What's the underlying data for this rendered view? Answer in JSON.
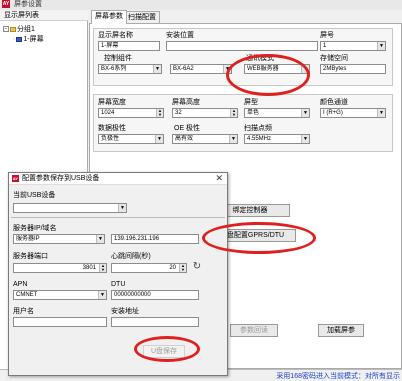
{
  "window": {
    "title": "屏参设置",
    "logo": "AY"
  },
  "tree": {
    "header": "显示屏列表",
    "group": {
      "expander": "−",
      "label": "分组1"
    },
    "screen": {
      "label": "1-屏幕"
    }
  },
  "tabs": [
    {
      "label": "屏幕参数"
    },
    {
      "label": "扫描配置"
    }
  ],
  "params": {
    "name_label": "显示屏名称",
    "name_value": "1-屏幕",
    "location_label": "安装位置",
    "location_value": "",
    "screen_no_label": "屏号",
    "screen_no_value": "1",
    "controller_label": "控制组件",
    "series_value": "BX-6系列",
    "model_value": "BX-6A2",
    "comm_label": "通讯模式",
    "comm_value": "WEB服务器",
    "storage_label": "存储空间",
    "storage_value": "2MBytes"
  },
  "screen_params": {
    "width_label": "屏幕宽度",
    "width_value": "1024",
    "height_label": "屏幕高度",
    "height_value": "32",
    "type_label": "屏型",
    "type_value": "单色",
    "color_label": "颜色通道",
    "color_value": "I (R+G)",
    "data_label": "数据极性",
    "data_value": "负极性",
    "oe_label": "OE 极性",
    "oe_value": "高有效",
    "scan_label": "扫描点频",
    "scan_value": "4.55MHz"
  },
  "buttons": {
    "bind": "绑定控制器",
    "udisk_gprs": "U盘配置GPRS/DTU",
    "params_recv": "参数回读",
    "load": "加载屏参"
  },
  "dialog": {
    "logo": "AY",
    "title": "配置参数保存到USB设备",
    "close_icon": "close-icon",
    "usb_label": "当前USB设备",
    "usb_value": "",
    "server_label": "服务器IP/域名",
    "server_type": "服务器IP",
    "server_ip": "139.196.231.196",
    "port_label": "服务器端口",
    "port_value": "3801",
    "heartbeat_label": "心跳间隔(秒)",
    "heartbeat_value": "20",
    "refresh_icon": "refresh-icon",
    "apn_label": "APN",
    "apn_value": "CMNET",
    "dtu_label": "DTU",
    "dtu_value": "00000000000",
    "user_label": "用户名",
    "user_value": "",
    "address_label": "安装地址",
    "address_value": "",
    "save_button": "U盘保存"
  },
  "status": {
    "text": "采用168密码进入当前模式：对所有显示"
  },
  "colors": {
    "highlight_oval": "#e0201f",
    "status_text": "#1a3fcf",
    "logo": "#c8102e"
  }
}
